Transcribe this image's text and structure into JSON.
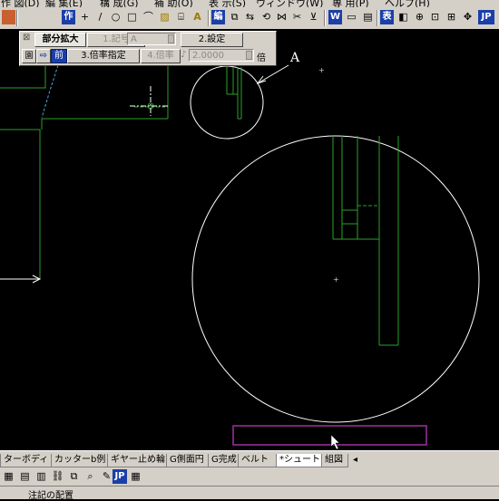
{
  "menubar": {
    "items": [
      "作 図(D)",
      "編 集(E)",
      "構 成(G)",
      "補 助(O)",
      "表 示(S)",
      "ウィンドウ(W)",
      "専 用(P)",
      "ヘルプ(H)"
    ]
  },
  "toolbar": {
    "buttons": [
      {
        "name": "create-mode-button",
        "glyph": "作",
        "style": "blue"
      },
      {
        "name": "cross-cursor-tool",
        "glyph": "+"
      },
      {
        "name": "line-tool",
        "glyph": "/"
      },
      {
        "name": "circle-tool",
        "glyph": "○"
      },
      {
        "name": "rectangle-tool",
        "glyph": "□"
      },
      {
        "name": "fillet-tool",
        "glyph": "⌒"
      },
      {
        "name": "hatch-tool",
        "glyph": "▨"
      },
      {
        "name": "dimension-tool",
        "glyph": "⌸"
      },
      {
        "name": "text-tool",
        "glyph": "A"
      },
      {
        "name": "edit-mode-button",
        "glyph": "編",
        "style": "blue"
      },
      {
        "name": "copy-tool",
        "glyph": "⧉"
      },
      {
        "name": "move-tool",
        "glyph": "⇆"
      },
      {
        "name": "rotate-tool",
        "glyph": "⟲"
      },
      {
        "name": "mirror-tool",
        "glyph": "⋈"
      },
      {
        "name": "trim-tool",
        "glyph": "✂"
      },
      {
        "name": "extend-tool",
        "glyph": "⊻"
      },
      {
        "name": "word-button",
        "glyph": "W",
        "style": "blue"
      },
      {
        "name": "frame-tool",
        "glyph": "▭"
      },
      {
        "name": "window-tool",
        "glyph": "▤"
      },
      {
        "name": "table-button",
        "glyph": "表",
        "style": "blue"
      },
      {
        "name": "layer-tool",
        "glyph": "◧"
      },
      {
        "name": "zoom-in-tool",
        "glyph": "⊕"
      },
      {
        "name": "zoom-window-tool",
        "glyph": "⊡"
      },
      {
        "name": "zoom-fit-tool",
        "glyph": "⊞"
      },
      {
        "name": "pan-tool",
        "glyph": "✥"
      },
      {
        "name": "jp-button",
        "glyph": "JP",
        "style": "blue"
      },
      {
        "name": "settings-tool",
        "glyph": "▦"
      }
    ]
  },
  "panel": {
    "title": "部分拡大",
    "btn_number": "1.記号",
    "input_mark": "A",
    "btn_settings": "2.設定",
    "icon_round": "園",
    "btn_front": "前",
    "btn_scale_spec": "3.倍率指定",
    "btn_scale": "4.倍率",
    "input_scale": "2.0000",
    "unit": "倍"
  },
  "drawing": {
    "detail_label": "A"
  },
  "tabs": {
    "items": [
      "ターボディ",
      "カッターb例",
      "ギヤー止め輪",
      "G側面円",
      "G完成",
      "ベルト",
      "*シュート",
      "組図"
    ],
    "active_index": 6
  },
  "status": {
    "text": "注記の配置"
  },
  "colors": {
    "background": "#000000",
    "geometry": "#2ca02c",
    "circle": "#ffffff",
    "leader": "#4aa8d8",
    "selection": "#a030a0"
  }
}
